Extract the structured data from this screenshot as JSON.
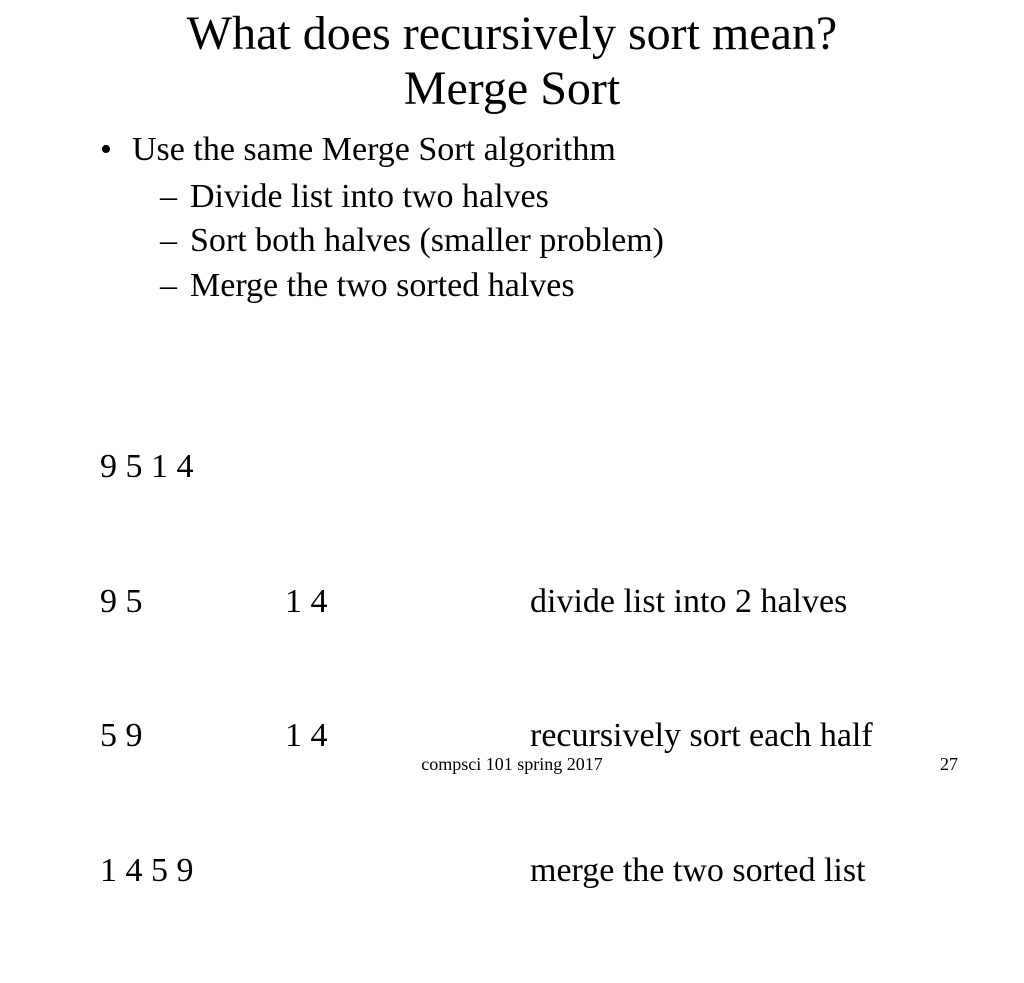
{
  "title_line1": "What does recursively sort mean?",
  "title_line2": "Merge Sort",
  "bullets": {
    "l1": "Use the same Merge Sort algorithm",
    "l2a": "Divide list into two halves",
    "l2b": "Sort both halves (smaller problem)",
    "l2c": "Merge the two sorted halves"
  },
  "example": {
    "r1c1": "9 5 1 4",
    "r2c1": "9 5",
    "r2c2": "1 4",
    "r2c3": "divide list into 2 halves",
    "r3c1": "5 9",
    "r3c2": "1 4",
    "r3c3": "recursively sort each half",
    "r4c1": "1 4 5 9",
    "r4c3": "merge the two sorted list"
  },
  "footer": {
    "center": "compsci 101 spring 2017",
    "right": "27"
  }
}
